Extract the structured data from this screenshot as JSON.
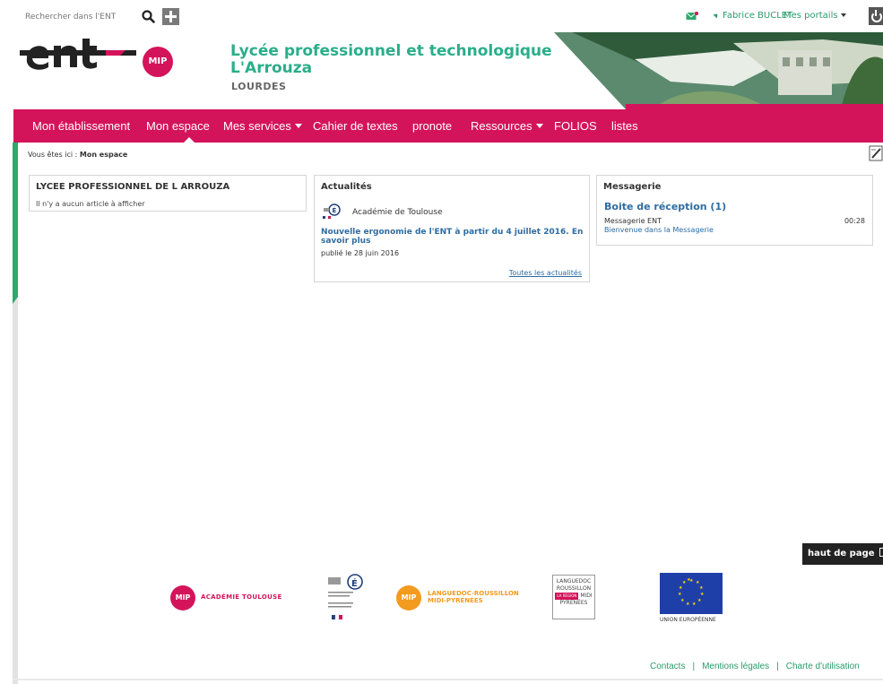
{
  "topbar": {
    "search_placeholder": "Rechercher dans l'ENT",
    "user_name": "Fabrice BUCLET",
    "portals_label": "Mes portails"
  },
  "banner": {
    "school_name": "Lycée professionnel et technologique L'Arrouza",
    "city": "LOURDES",
    "mip_label": "MIP"
  },
  "nav": {
    "items": [
      {
        "label": "Mon établissement"
      },
      {
        "label": "Mon espace"
      },
      {
        "label": "Mes services"
      },
      {
        "label": "Cahier de textes"
      },
      {
        "label": "pronote"
      },
      {
        "label": "Ressources"
      },
      {
        "label": "FOLIOS"
      },
      {
        "label": "listes"
      }
    ]
  },
  "breadcrumb": {
    "prefix": "Vous êtes ici :",
    "current": "Mon espace"
  },
  "portlets": {
    "school": {
      "title": "LYCEE PROFESSIONNEL DE L ARROUZA",
      "empty_text": "Il n'y a aucun article à afficher"
    },
    "news": {
      "title": "Actualités",
      "source": "Académie de Toulouse",
      "headline": "Nouvelle ergonomie de l'ENT à partir du 4 juillet 2016. En savoir plus",
      "date": "publié le 28 juin 2016",
      "all_link": "Toutes les actualités"
    },
    "mail": {
      "title": "Messagerie",
      "inbox": "Boite de réception (1)",
      "from": "Messagerie ENT",
      "time": "00:28",
      "subject": "Bienvenue dans la Messagerie"
    }
  },
  "back_to_top": "haut de page",
  "footer": {
    "mip_label": "MIP",
    "mip_text": "ACADÉMIE TOULOUSE",
    "region_text_1": "LANGUEDOC-ROUSSILLON",
    "region_text_2": "MIDI-PYRÉNÉES",
    "region_box_1": "LANGUEDOC",
    "region_box_2": "ROUSSILLON",
    "region_box_badge": "LA RÉGION",
    "region_box_3": "MIDI",
    "region_box_4": "PYRÉNÉES",
    "eu_label": "UNION EUROPÉENNE",
    "links": [
      "Contacts",
      "Mentions légales",
      "Charte d'utilisation"
    ]
  },
  "colors": {
    "brand_pink": "#d4145a",
    "brand_green": "#2aae8a",
    "link_blue": "#2d6ca2"
  }
}
